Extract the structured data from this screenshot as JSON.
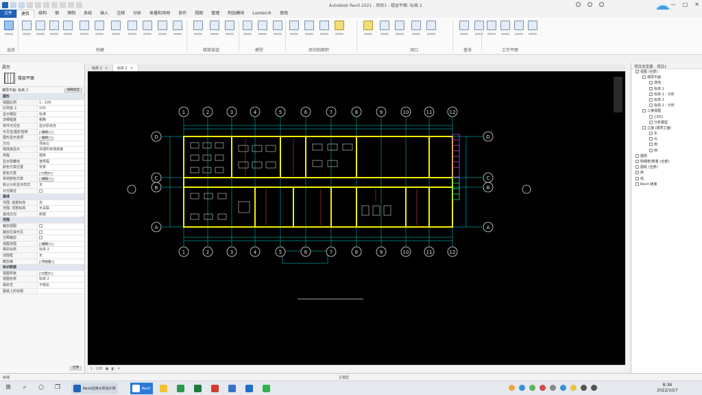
{
  "app": {
    "title": "Autodesk Revit 2021 - 项目1 - 楼层平面: 标高 2",
    "window_controls": [
      "—",
      "□",
      "✕"
    ]
  },
  "menu": {
    "tabs": [
      {
        "label": "文件"
      },
      {
        "label": "建筑"
      },
      {
        "label": "结构"
      },
      {
        "label": "钢"
      },
      {
        "label": "预制"
      },
      {
        "label": "系统"
      },
      {
        "label": "插入"
      },
      {
        "label": "注释"
      },
      {
        "label": "分析"
      },
      {
        "label": "体量和场地"
      },
      {
        "label": "协作"
      },
      {
        "label": "视图"
      },
      {
        "label": "管理"
      },
      {
        "label": "附加模块"
      },
      {
        "label": "Lumion®"
      },
      {
        "label": "修改"
      }
    ]
  },
  "ribbon": {
    "panels": [
      {
        "label": "选择"
      },
      {
        "label": "构建"
      },
      {
        "label": "楼梯坡道"
      },
      {
        "label": "模型"
      },
      {
        "label": "房间和面积"
      },
      {
        "label": "洞口"
      },
      {
        "label": "基准"
      },
      {
        "label": "工作平面"
      }
    ]
  },
  "properties": {
    "title": "属性",
    "type_name": "楼层平面",
    "selector": "楼层平面: 标高 2",
    "edit_type": "编辑类型",
    "rows": [
      {
        "k": "图形",
        "v": "",
        "group": true
      },
      {
        "k": "视图比例",
        "v": "1 : 100"
      },
      {
        "k": "比例值 1:",
        "v": "100"
      },
      {
        "k": "显示模型",
        "v": "标准"
      },
      {
        "k": "详细程度",
        "v": "粗略"
      },
      {
        "k": "零件可见性",
        "v": "显示原状态"
      },
      {
        "k": "可见性/图形替换",
        "v": "编辑...",
        "btn": true
      },
      {
        "k": "图形显示选项",
        "v": "编辑...",
        "btn": true
      },
      {
        "k": "方向",
        "v": "项目北"
      },
      {
        "k": "墙连接显示",
        "v": "清理所有墙连接"
      },
      {
        "k": "规程",
        "v": "建筑"
      },
      {
        "k": "显示隐藏线",
        "v": "按规程"
      },
      {
        "k": "颜色方案位置",
        "v": "背景"
      },
      {
        "k": "颜色方案",
        "v": "<无>",
        "btn": true
      },
      {
        "k": "系统颜色方案",
        "v": "编辑...",
        "btn": true
      },
      {
        "k": "默认分析显示样式",
        "v": "无"
      },
      {
        "k": "日光路径",
        "v": "",
        "check": true
      },
      {
        "k": "基线",
        "v": "",
        "group": true
      },
      {
        "k": "范围: 底部标高",
        "v": "无"
      },
      {
        "k": "范围: 顶部标高",
        "v": "无关联"
      },
      {
        "k": "基线方向",
        "v": "俯视"
      },
      {
        "k": "范围",
        "v": "",
        "group": true
      },
      {
        "k": "裁剪视图",
        "v": "",
        "check": true
      },
      {
        "k": "裁剪区域可见",
        "v": "",
        "check": true
      },
      {
        "k": "注释裁剪",
        "v": "",
        "check": true
      },
      {
        "k": "视图范围",
        "v": "编辑...",
        "btn": true
      },
      {
        "k": "相关标高",
        "v": "标高 2"
      },
      {
        "k": "范围框",
        "v": "无"
      },
      {
        "k": "截剪裁",
        "v": "不剪裁",
        "btn": true
      },
      {
        "k": "标识数据",
        "v": "",
        "group": true
      },
      {
        "k": "视图样板",
        "v": "<无>",
        "btn": true
      },
      {
        "k": "视图名称",
        "v": "标高 2"
      },
      {
        "k": "相关性",
        "v": "不相关"
      },
      {
        "k": "图纸上的标题",
        "v": ""
      }
    ],
    "apply": "应用"
  },
  "view_tabs": [
    {
      "label": "标高 1",
      "active": false
    },
    {
      "label": "标高 2",
      "active": true
    }
  ],
  "drawing": {
    "axis_labels": [
      "1",
      "2",
      "3",
      "4",
      "5",
      "6",
      "7",
      "8",
      "9",
      "10",
      "11",
      "12"
    ],
    "row_labels": [
      "D",
      "C",
      "B",
      "A"
    ]
  },
  "view_bar": {
    "scale": "1 : 100"
  },
  "browser": {
    "title": "项目浏览器 - 项目1",
    "nodes": [
      {
        "label": "视图 (全部)",
        "level": 0
      },
      {
        "label": "楼层平面",
        "level": 1
      },
      {
        "label": "场地",
        "level": 2
      },
      {
        "label": "标高 1",
        "level": 2
      },
      {
        "label": "标高 1 - 分析",
        "level": 2
      },
      {
        "label": "标高 2",
        "level": 2
      },
      {
        "label": "标高 2 - 分析",
        "level": 2
      },
      {
        "label": "三维视图",
        "level": 1
      },
      {
        "label": "{3D}",
        "level": 2
      },
      {
        "label": "分析模型",
        "level": 2
      },
      {
        "label": "立面 (建筑立面)",
        "level": 1
      },
      {
        "label": "东",
        "level": 2
      },
      {
        "label": "北",
        "level": 2
      },
      {
        "label": "南",
        "level": 2
      },
      {
        "label": "西",
        "level": 2
      },
      {
        "label": "图例",
        "level": 0
      },
      {
        "label": "明细表/数量 (全部)",
        "level": 0
      },
      {
        "label": "图纸 (全部)",
        "level": 0
      },
      {
        "label": "族",
        "level": 0
      },
      {
        "label": "组",
        "level": 0
      },
      {
        "label": "Revit 链接",
        "level": 0
      }
    ]
  },
  "status": {
    "text": "就绪",
    "model": "主模型"
  },
  "taskbar": {
    "apps": [
      {
        "label": "Revit应用大师设计师",
        "color": "#1f63b8"
      },
      {
        "label": "Revit",
        "color": "#2b7bd6"
      }
    ],
    "time": "8:38",
    "date": "2022/10/7"
  }
}
